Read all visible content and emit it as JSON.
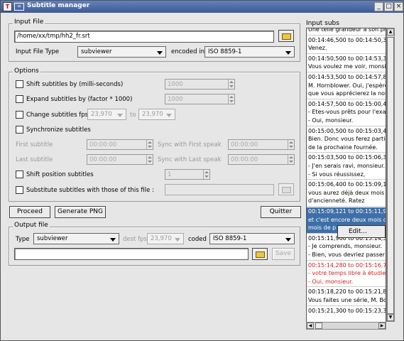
{
  "window": {
    "title": "Subtitle manager",
    "app_icon": "T",
    "sys_icon": "=",
    "controls": [
      "_",
      "□",
      "×"
    ]
  },
  "input_file": {
    "group_label": "Input File",
    "path": "/home/xx/tmp/hh2_fr.srt",
    "type_label": "Input File Type",
    "type_value": "subviewer",
    "encoded_label": "encoded in",
    "encoding_value": "ISO 8859-1"
  },
  "options": {
    "group_label": "Options",
    "shift_label": "Shift subtitles by (milli-seconds)",
    "shift_value": "1000",
    "expand_label": "Expand subtitles by (factor * 1000)",
    "expand_value": "1000",
    "fps_label": "Change subtitles fps",
    "fps_from": "23,970",
    "fps_to_label": "to",
    "fps_to": "23,970",
    "sync_label": "Synchronize subtitles",
    "first_subtitle_label": "First subtitle",
    "first_subtitle_value": "00:00:00",
    "sync_first_label": "Sync with First speak",
    "sync_first_value": "00:00:00",
    "last_subtitle_label": "Last subtitle",
    "last_subtitle_value": "00:00:00",
    "sync_last_label": "Sync with Last speak",
    "sync_last_value": "00:00:00",
    "shift_pos_label": "Shift position subtitles",
    "shift_pos_value": "1",
    "substitute_label": "Substitute subtitles with those of this file :"
  },
  "actions": {
    "proceed": "Proceed",
    "generate": "Generate PNG",
    "quit": "Quitter"
  },
  "output_file": {
    "group_label": "Output file",
    "type_label": "Type",
    "type_value": "subviewer",
    "dest_fps_label": "dest fps",
    "dest_fps_value": "23,970",
    "coded_label": "coded",
    "encoding_value": "ISO 8859-1",
    "path": "",
    "save_label": "Save"
  },
  "subs": {
    "label": "Input subs",
    "lines": [
      {
        "text": "Une telle grandeur à son pr",
        "style": "normal"
      },
      {
        "text": "00:14:46,500 to 00:14:50,3",
        "style": "normal"
      },
      {
        "text": "Venez.",
        "style": "normal"
      },
      {
        "text": "00:14:50,500 to 00:14:53,3",
        "style": "normal"
      },
      {
        "text": "Vous voulez me voir, monsie",
        "style": "normal"
      },
      {
        "text": "00:14:53,500 to 00:14:57,8",
        "style": "normal"
      },
      {
        "text": "M. Hornblower. Oui, j'espère",
        "style": "normal"
      },
      {
        "text": "que vous apprécierez la nou",
        "style": "normal"
      },
      {
        "text": "00:14:57,500 to 00:15:00,4",
        "style": "normal"
      },
      {
        "text": "- Etes-vous prêts pour l'exa",
        "style": "normal"
      },
      {
        "text": "- Oui, monsieur.",
        "style": "normal"
      },
      {
        "text": "00:15:00,500 to 00:15:03,4",
        "style": "normal"
      },
      {
        "text": "Bien. Donc vous ferez partie",
        "style": "normal"
      },
      {
        "text": "de la prochaine fournée.",
        "style": "normal"
      },
      {
        "text": "00:15:03,500 to 00:15:06,3",
        "style": "normal"
      },
      {
        "text": "- J'en serais ravi, monsieur.",
        "style": "normal"
      },
      {
        "text": "- Si vous réussissez,",
        "style": "normal"
      },
      {
        "text": "00:15:06,400 to 00:15:09,1",
        "style": "normal"
      },
      {
        "text": "vous aurez déjà deux mois",
        "style": "normal"
      },
      {
        "text": "d'ancienneté. Ratez",
        "style": "normal"
      },
      {
        "text": "00:15:09,121 to 00:15:11,9",
        "style": "sel"
      },
      {
        "text": "et c'est encore deux mois de",
        "style": "sel"
      },
      {
        "text": "mois de p",
        "style": "sel"
      },
      {
        "text": "00:15:11,900 to 00:15:14,3",
        "style": "normal"
      },
      {
        "text": "- Je comprends, monsieur.",
        "style": "normal"
      },
      {
        "text": "- Bien, vous devriez passer",
        "style": "normal"
      },
      {
        "text": "00:15:14,280 to 00:15:16,7",
        "style": "red"
      },
      {
        "text": "- votre temps libre à étudier",
        "style": "red"
      },
      {
        "text": "- Oui, monsieur.",
        "style": "red"
      },
      {
        "text": "00:15:18,220 to 00:15:21,8",
        "style": "normal"
      },
      {
        "text": "Vous faites une série, M. Bo",
        "style": "normal"
      },
      {
        "text": "00:15:21,300 to 00:15:23,3",
        "style": "normal"
      }
    ]
  },
  "context_menu": {
    "edit": "Edit..."
  }
}
